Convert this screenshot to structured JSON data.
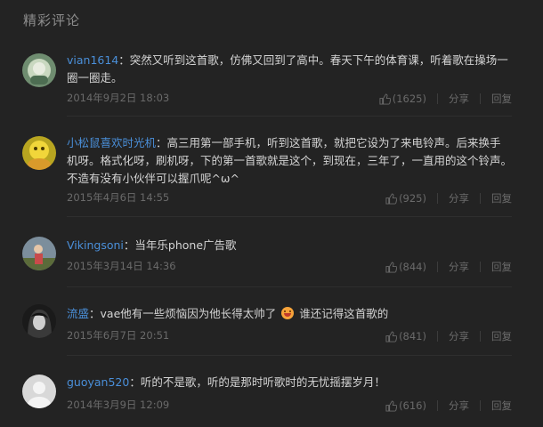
{
  "section": {
    "title": "精彩评论"
  },
  "labels": {
    "share": "分享",
    "reply": "回复"
  },
  "comments": [
    {
      "user": "vian1614",
      "text": "突然又听到这首歌，仿佛又回到了高中。春天下午的体育课，听着歌在操场一圈一圈走。",
      "time": "2014年9月2日 18:03",
      "likes": "(1625)"
    },
    {
      "user": "小松鼠喜欢时光机",
      "text": "高三用第一部手机，听到这首歌，就把它设为了来电铃声。后来换手机呀。格式化呀，刷机呀，下的第一首歌就是这个，到现在，三年了，一直用的这个铃声。不造有没有小伙伴可以握爪呢^ω^",
      "time": "2015年4月6日 14:55",
      "likes": "(925)"
    },
    {
      "user": "Vikingsoni",
      "text": "当年乐phone广告歌",
      "time": "2015年3月14日 14:36",
      "likes": "(844)"
    },
    {
      "user": "流盛",
      "text_before": "vae他有一些烦恼因为他长得太帅了",
      "emoji": "grin-emoji",
      "text_after": "谁还记得这首歌的",
      "time": "2015年6月7日 20:51",
      "likes": "(841)"
    },
    {
      "user": "guoyan520",
      "text": "听的不是歌，听的是那时听歌时的无忧摇摆岁月！",
      "time": "2014年3月9日 12:09",
      "likes": "(616)"
    }
  ]
}
